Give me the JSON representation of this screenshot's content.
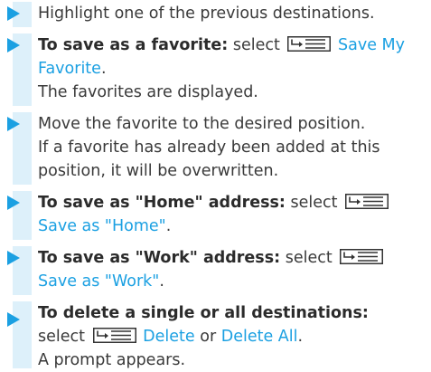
{
  "colors": {
    "accent": "#1ba0e2",
    "bar": "#ddf0fa",
    "text": "#3a3a3a"
  },
  "icons": {
    "menu": "menu-icon"
  },
  "steps": [
    {
      "text": "Highlight one of the previous destinations."
    },
    {
      "lead": "To save as a favorite:",
      "select": "select",
      "option": "Save My Favorite",
      "end": ".",
      "result": "The favorites are displayed."
    },
    {
      "text1": "Move the favorite to the desired position.",
      "text2": "If a favorite has already been added at this position, it will be overwritten."
    },
    {
      "lead": "To save as \"Home\" address:",
      "select": "select",
      "option": "Save as \"Home\"",
      "end": "."
    },
    {
      "lead": "To save as \"Work\" address:",
      "select": "select",
      "option": "Save as \"Work\"",
      "end": "."
    },
    {
      "lead": "To delete a single or all destinations:",
      "select": "select",
      "option1": "Delete",
      "or": "or",
      "option2": "Delete All",
      "end": ".",
      "result": "A prompt appears."
    }
  ]
}
